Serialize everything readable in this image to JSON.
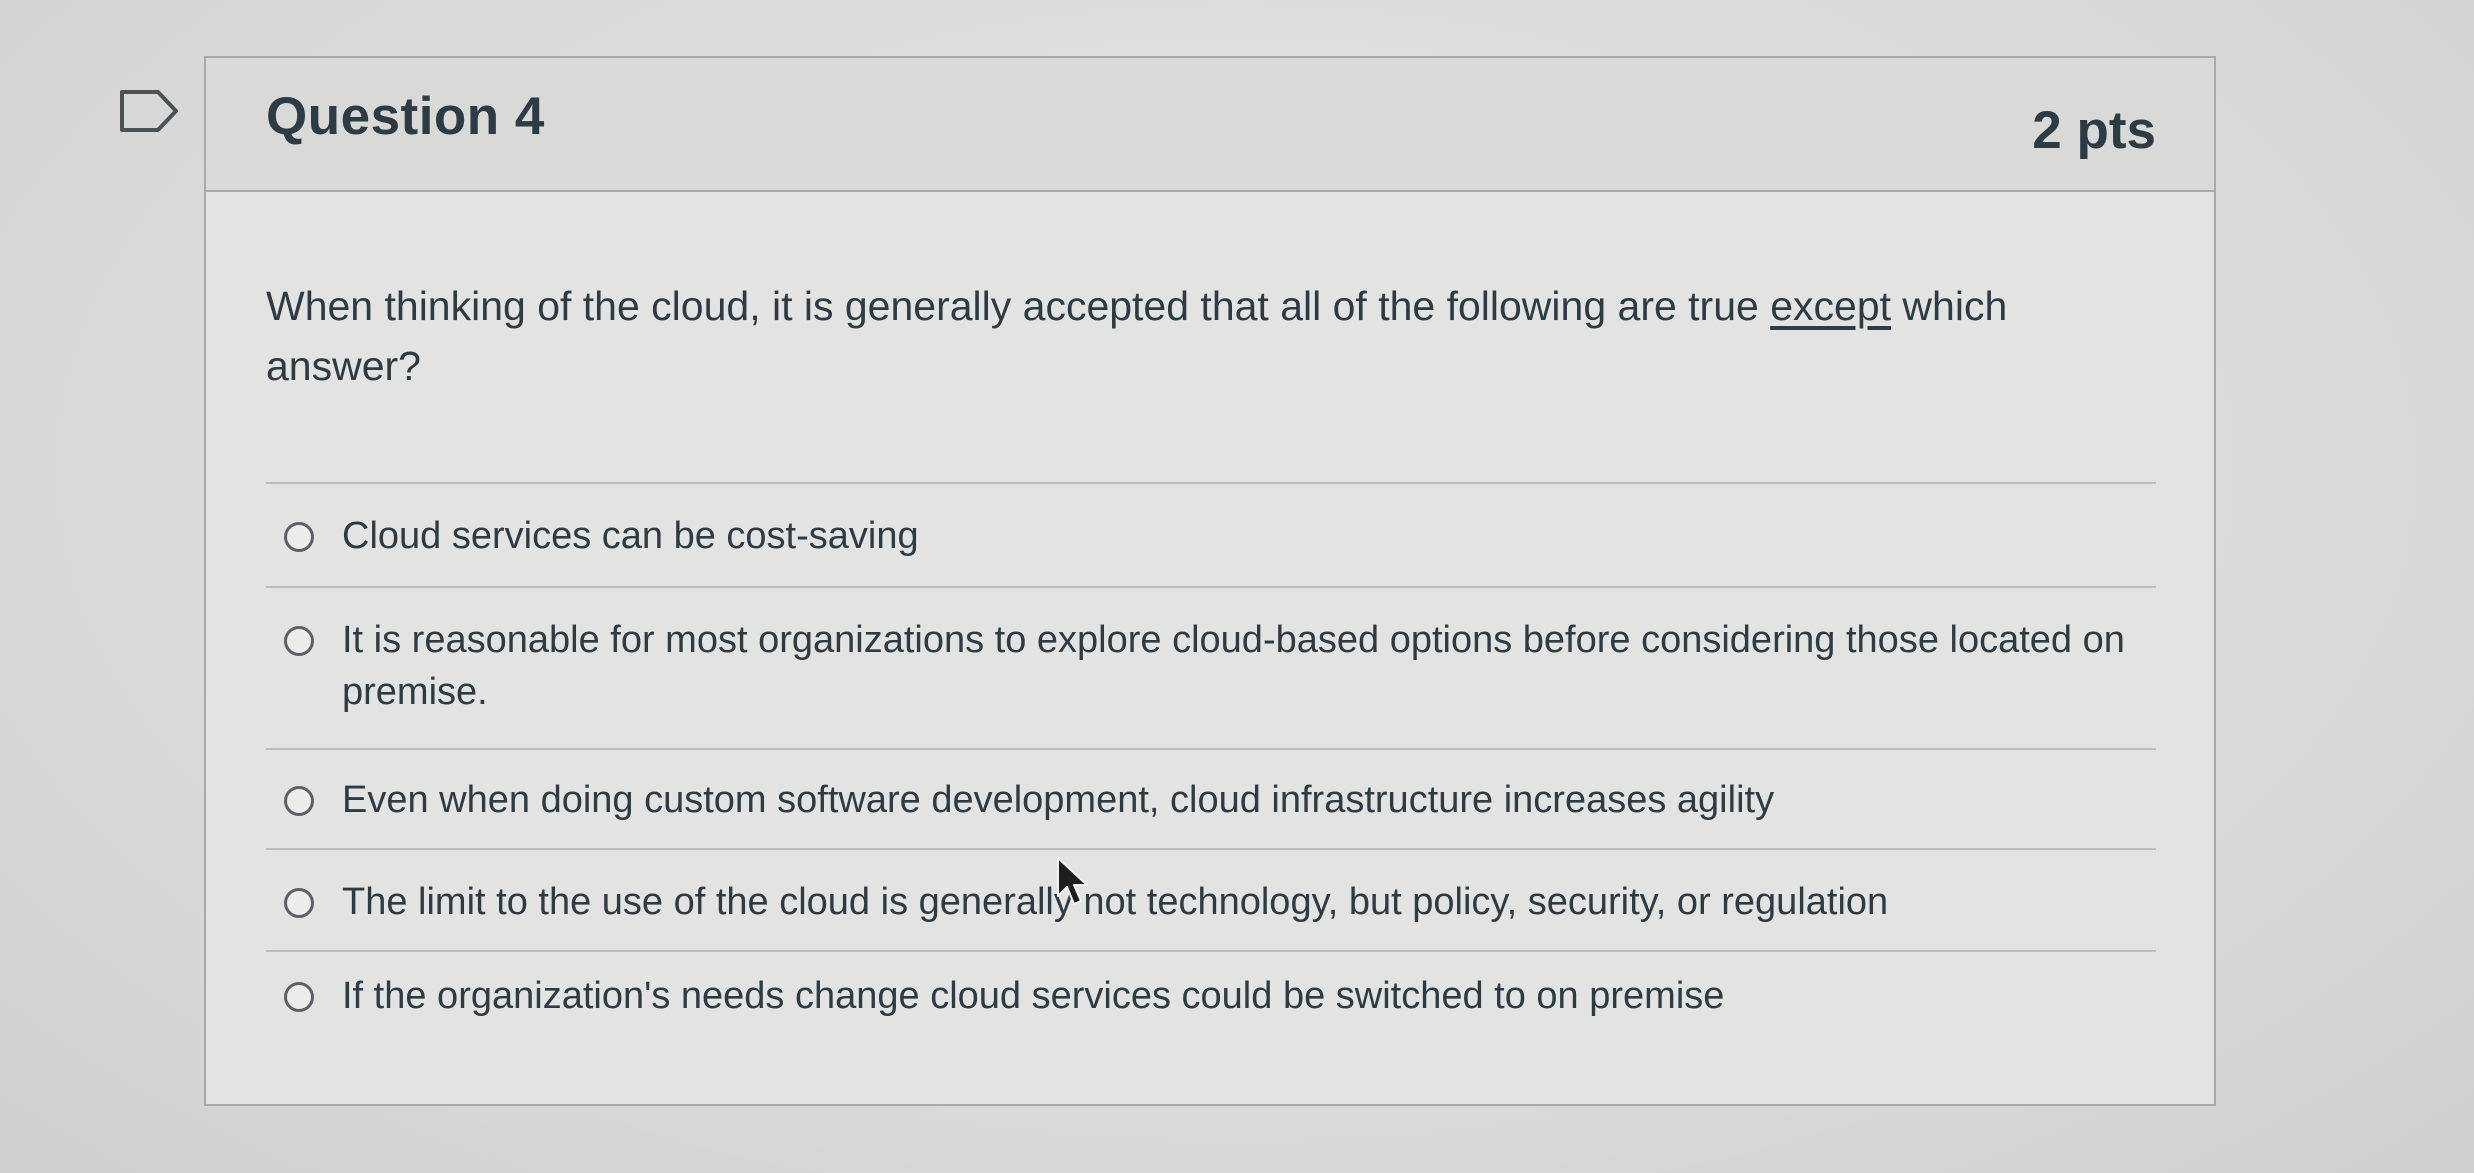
{
  "question": {
    "title": "Question 4",
    "points": "2 pts",
    "text_before": "When thinking of the cloud, it is generally accepted that all of the following are true ",
    "text_emphasis": "except",
    "text_after": " which answer?"
  },
  "answers": [
    {
      "label": "Cloud services can be cost-saving",
      "selected": false
    },
    {
      "label": "It is reasonable for most organizations to explore cloud-based options before considering those located on premise.",
      "selected": false
    },
    {
      "label": "Even when doing custom software development, cloud infrastructure increases agility",
      "selected": false
    },
    {
      "label": "The limit to the use of the cloud is generally not technology, but policy, security, or regulation",
      "selected": false
    },
    {
      "label": "If the organization's needs change cloud services could be switched to on premise",
      "selected": false
    }
  ],
  "icons": {
    "flag": "flag-icon",
    "radio": "radio-button-icon",
    "cursor": "mouse-pointer-icon"
  },
  "colors": {
    "text": "#2d3b45",
    "border": "#a9aaa8",
    "header_bg": "#d9d9d7"
  }
}
